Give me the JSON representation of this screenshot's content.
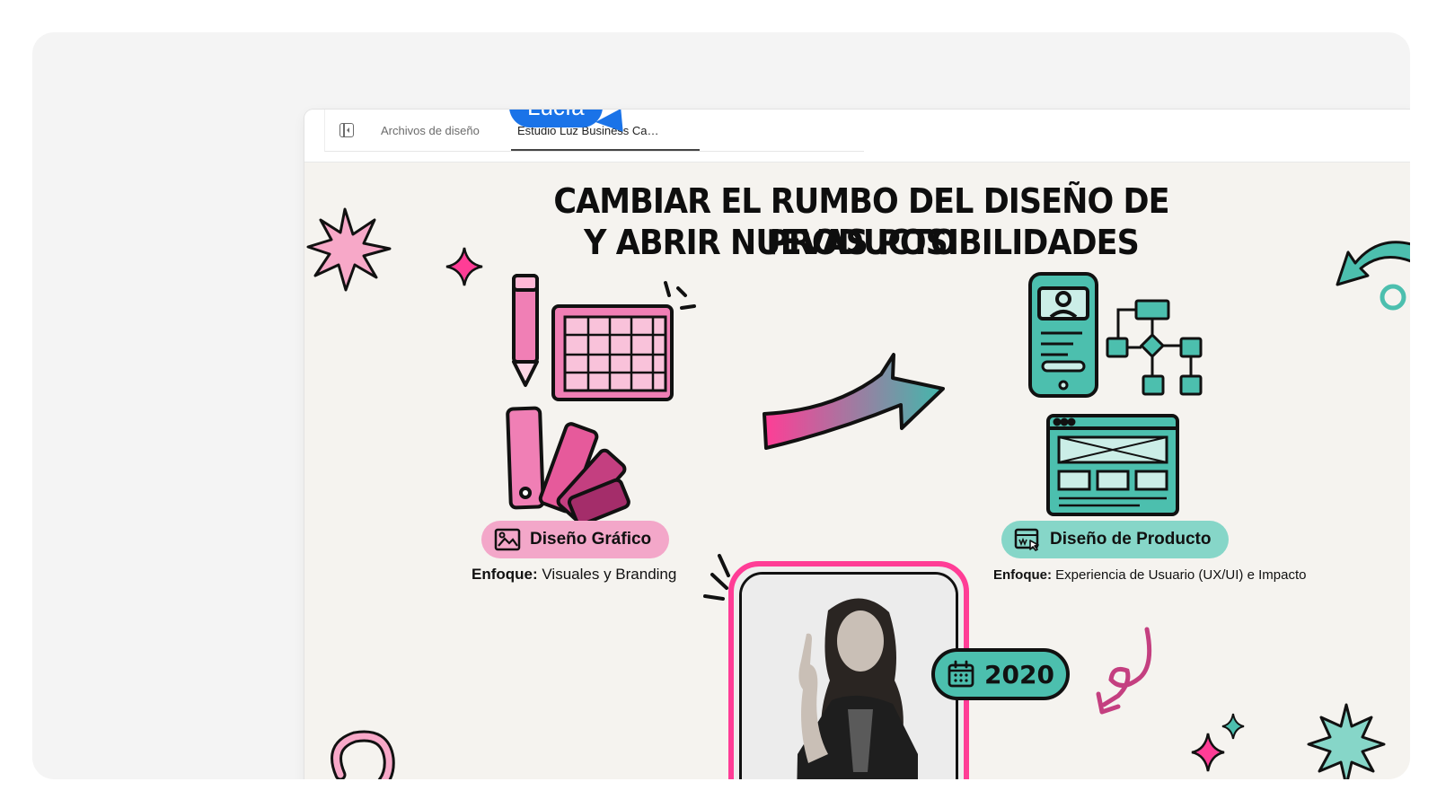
{
  "tabs": {
    "files_label": "Archivos de diseño",
    "active_doc_label": "Estudio Luz Business Ca…"
  },
  "collaborator": {
    "name": "Lucía",
    "color": "#1a73e8"
  },
  "slide": {
    "title_line1": "CAMBIAR EL RUMBO DEL DISEÑO DE PRODUCTO",
    "title_line2": "Y ABRIR NUEVAS POSIBILIDADES",
    "left": {
      "label": "Diseño Gráfico",
      "focus_prefix": "Enfoque:",
      "focus_text": "Visuales y Branding",
      "color": "#f3a7c9"
    },
    "right": {
      "label": "Diseño de Producto",
      "focus_prefix": "Enfoque:",
      "focus_text": "Experiencia de Usuario (UX/UI) e Impacto",
      "color": "#86d6c8"
    },
    "year": "2020",
    "accent_pink": "#ff3d96",
    "accent_teal": "#4cbfae"
  }
}
